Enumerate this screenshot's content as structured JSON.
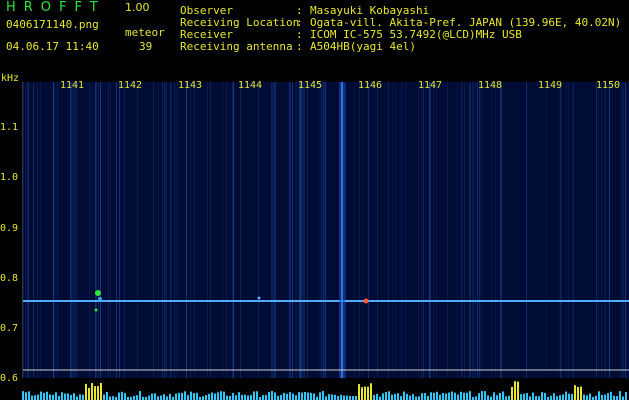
{
  "app": {
    "title": "HROFFT",
    "version": "1.00"
  },
  "file": {
    "name": "0406171140.png",
    "datetime": "04.06.17 11:40"
  },
  "meteor": {
    "label": "meteor",
    "count": "39"
  },
  "info": [
    {
      "key": "Observer",
      "value": "Masayuki Kobayashi"
    },
    {
      "key": "Receiving Location",
      "value": "Ogata-vill. Akita-Pref. JAPAN (139.96E, 40.02N)"
    },
    {
      "key": "Receiver",
      "value": "ICOM IC-575 53.7492(@LCD)MHz USB"
    },
    {
      "key": "Receiving antenna",
      "value": "A504HB(yagi 4el)"
    }
  ],
  "axis": {
    "y_unit": "kHz",
    "y_ticks": [
      "1.1",
      "1.0",
      "0.9",
      "0.8",
      "0.7",
      "0.6"
    ],
    "x_ticks": [
      "1141",
      "1142",
      "1143",
      "1144",
      "1145",
      "1146",
      "1147",
      "1148",
      "1149",
      "1150"
    ]
  },
  "colors": {
    "header_text": "#e6e62e",
    "title_text": "#2ee63a",
    "plot_bg": "#000c33"
  }
}
